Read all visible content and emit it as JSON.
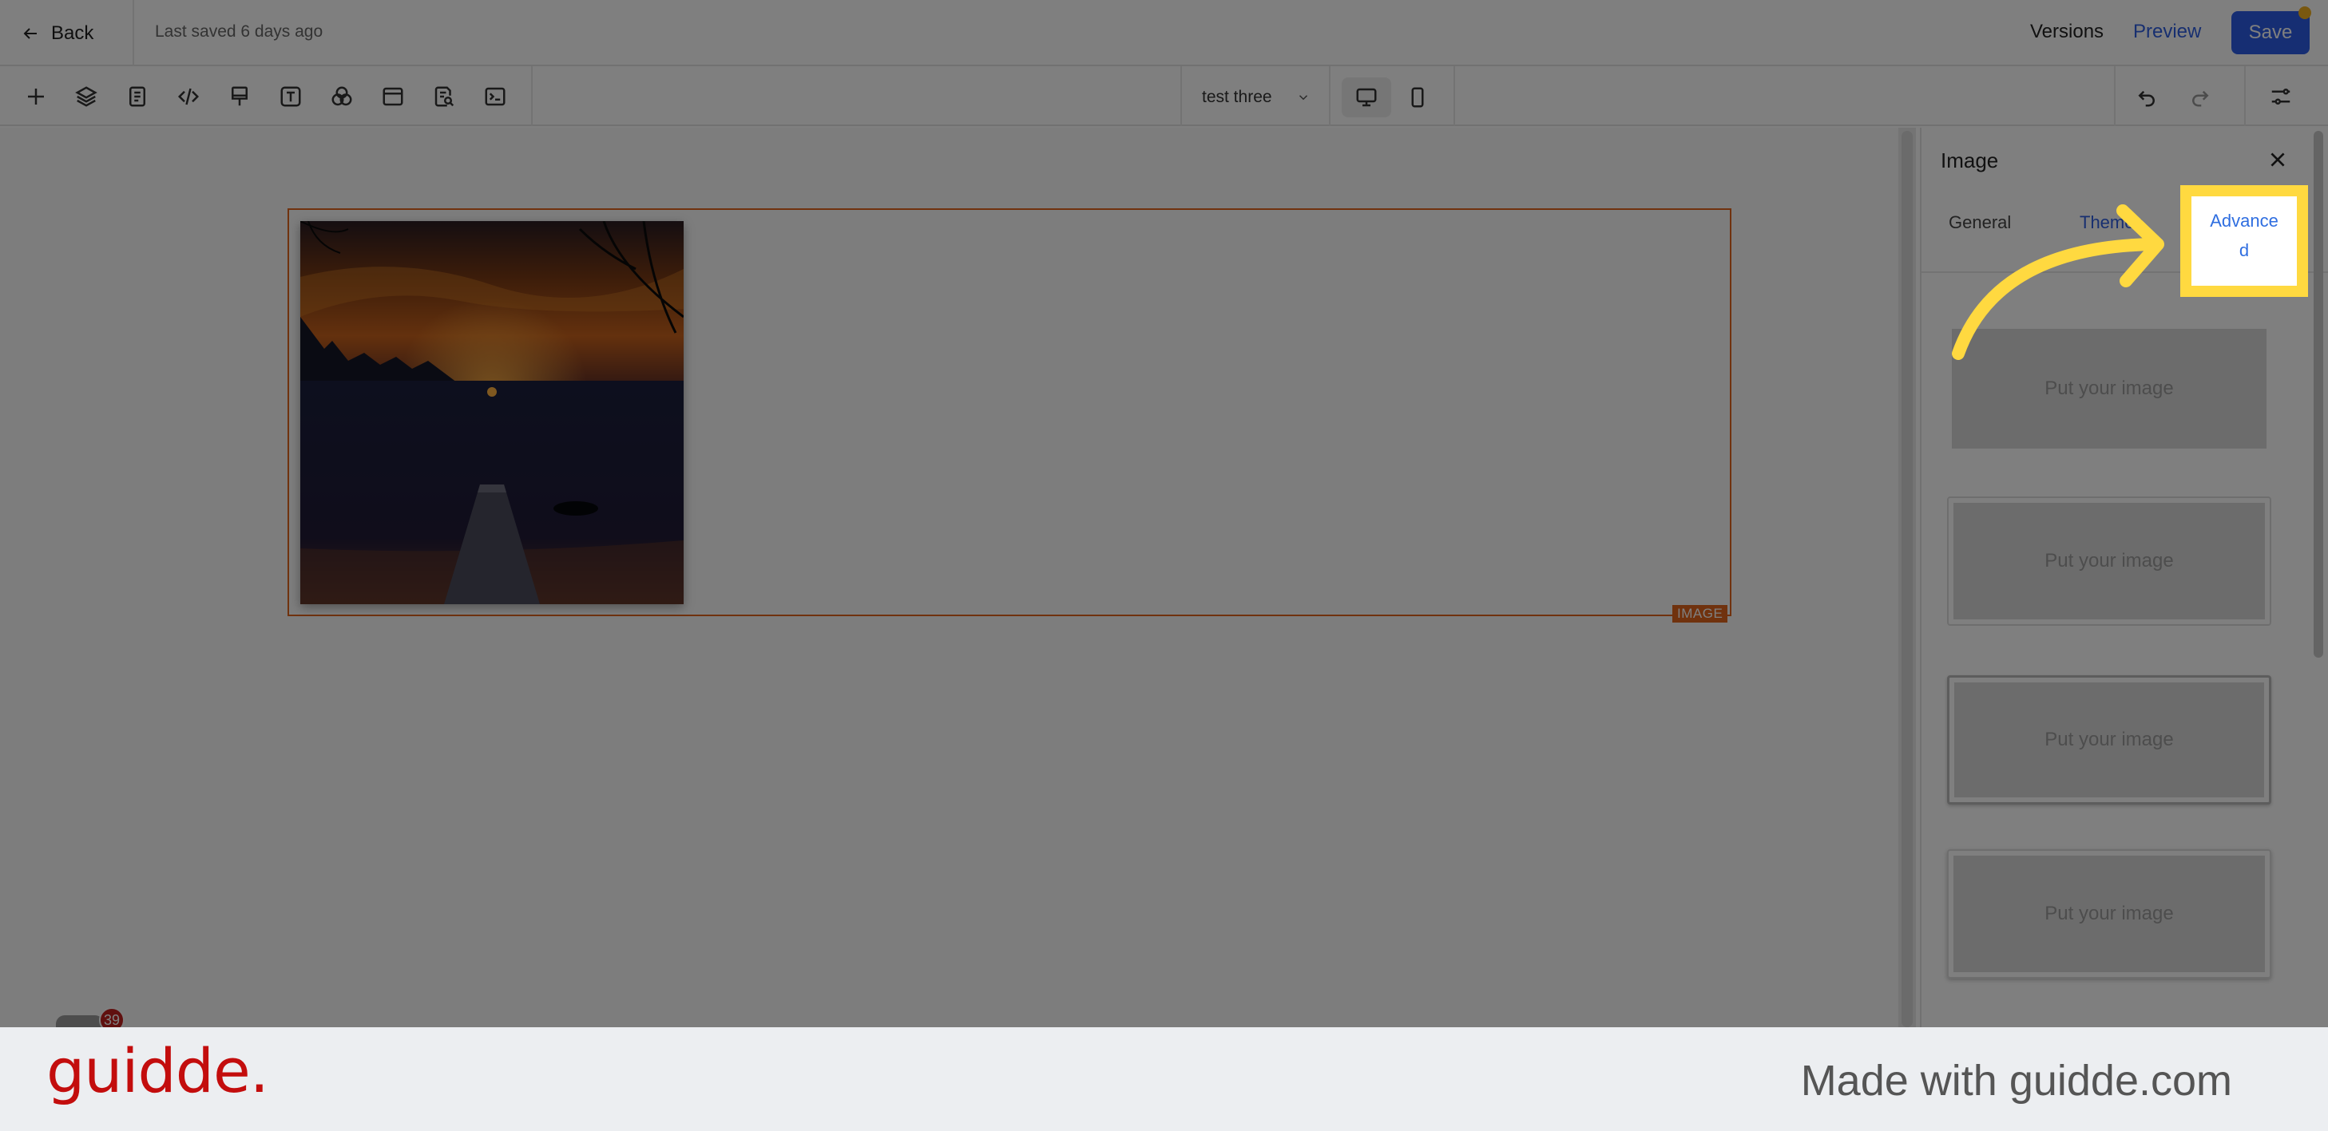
{
  "header": {
    "back_label": "Back",
    "saved_text": "Last saved 6 days ago",
    "versions_label": "Versions",
    "preview_label": "Preview",
    "save_label": "Save"
  },
  "toolbar": {
    "tools": [
      "add-icon",
      "layers-icon",
      "page-icon",
      "code-icon",
      "paint-icon",
      "text-icon",
      "shapes-icon",
      "browser-icon",
      "search-doc-icon",
      "terminal-icon"
    ],
    "page_name": "test three",
    "devices": [
      "desktop-icon",
      "mobile-icon"
    ]
  },
  "canvas": {
    "block_badge": "IMAGE"
  },
  "panel": {
    "title": "Image",
    "tabs": {
      "general": "General",
      "themes": "Themes",
      "advanced": "Advanced"
    },
    "theme_placeholder": "Put your image",
    "theme_cards": [
      {
        "placeholder": "Put your image"
      },
      {
        "placeholder": "Put your image"
      },
      {
        "placeholder": "Put your image"
      },
      {
        "placeholder": "Put your image"
      }
    ]
  },
  "highlight": {
    "label_line1": "Advance",
    "label_line2": "d",
    "color": "#ffd940"
  },
  "notification": {
    "count": "39"
  },
  "footer": {
    "logo": "guidde.",
    "made_with": "Made with guidde.com"
  }
}
